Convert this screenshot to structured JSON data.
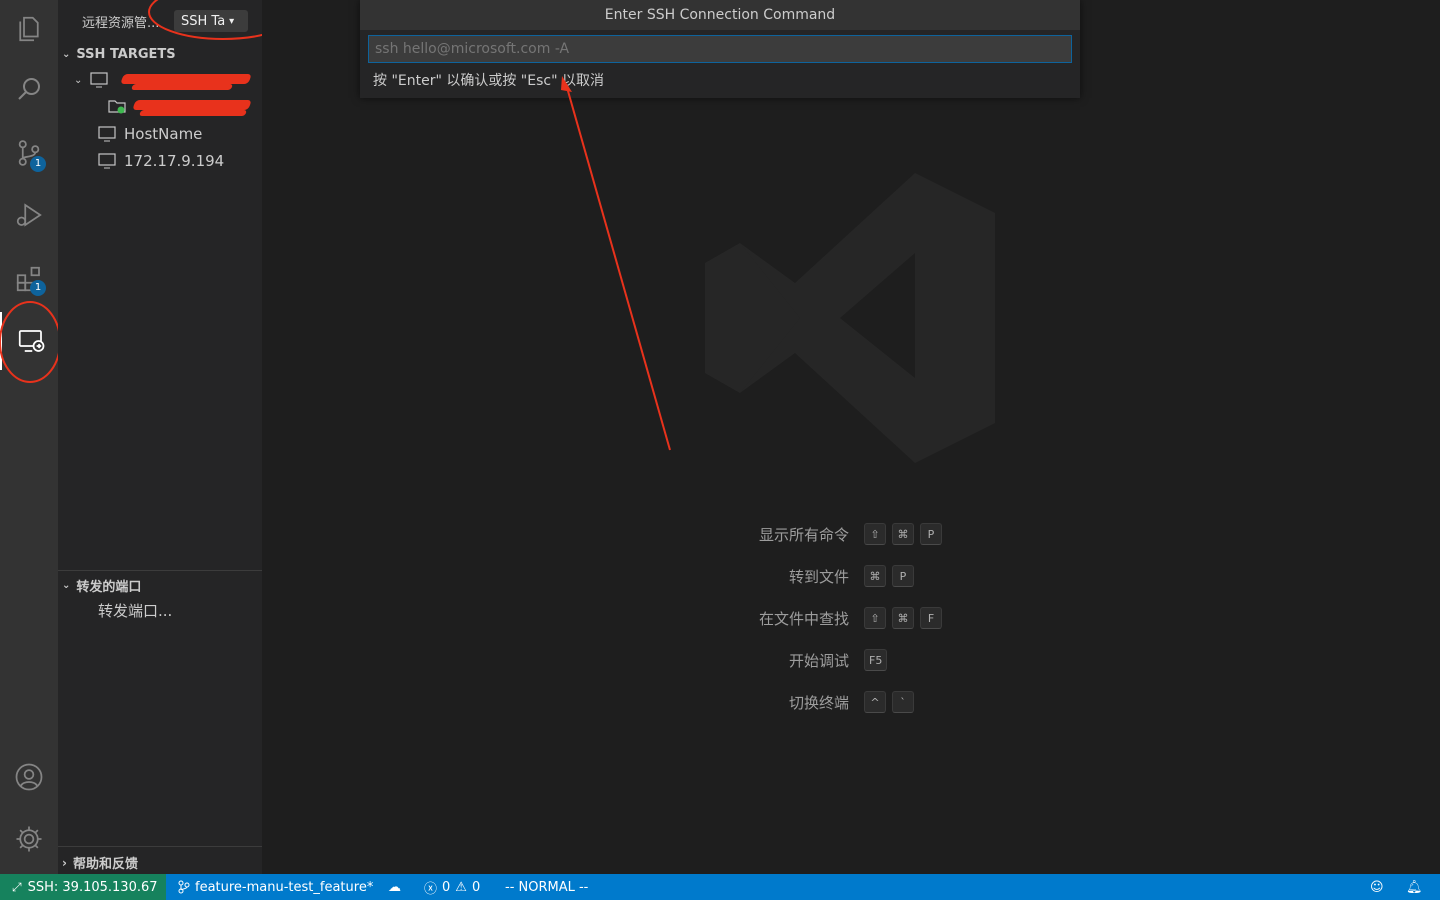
{
  "quick_input": {
    "title": "Enter SSH Connection Command",
    "placeholder": "ssh hello@microsoft.com -A",
    "message": "按 \"Enter\" 以确认或按 \"Esc\" 以取消"
  },
  "activity_bar": {
    "source_control_badge": "1",
    "extensions_badge": "1"
  },
  "sidebar": {
    "header": "远程资源管...",
    "dropdown_value": "SSH Ta",
    "ssh_targets_title": "SSH TARGETS",
    "targets": [
      {
        "label": "HostName"
      },
      {
        "label": "172.17.9.194"
      }
    ],
    "forwarded_ports_title": "转发的端口",
    "forward_port_action": "转发端口...",
    "help_title": "帮助和反馈"
  },
  "shortcuts": [
    {
      "label": "显示所有命令",
      "keys": [
        "⇧",
        "⌘",
        "P"
      ]
    },
    {
      "label": "转到文件",
      "keys": [
        "⌘",
        "P"
      ]
    },
    {
      "label": "在文件中查找",
      "keys": [
        "⇧",
        "⌘",
        "F"
      ]
    },
    {
      "label": "开始调试",
      "keys": [
        "F5"
      ]
    },
    {
      "label": "切换终端",
      "keys": [
        "^",
        "`"
      ]
    }
  ],
  "status_bar": {
    "remote": "SSH: 39.105.130.67",
    "branch": "feature-manu-test_feature*",
    "errors": "0",
    "warnings": "0",
    "mode": "-- NORMAL --"
  },
  "colors": {
    "accent": "#007acc",
    "remote_indicator": "#16825d",
    "annotation": "#e8321c"
  }
}
